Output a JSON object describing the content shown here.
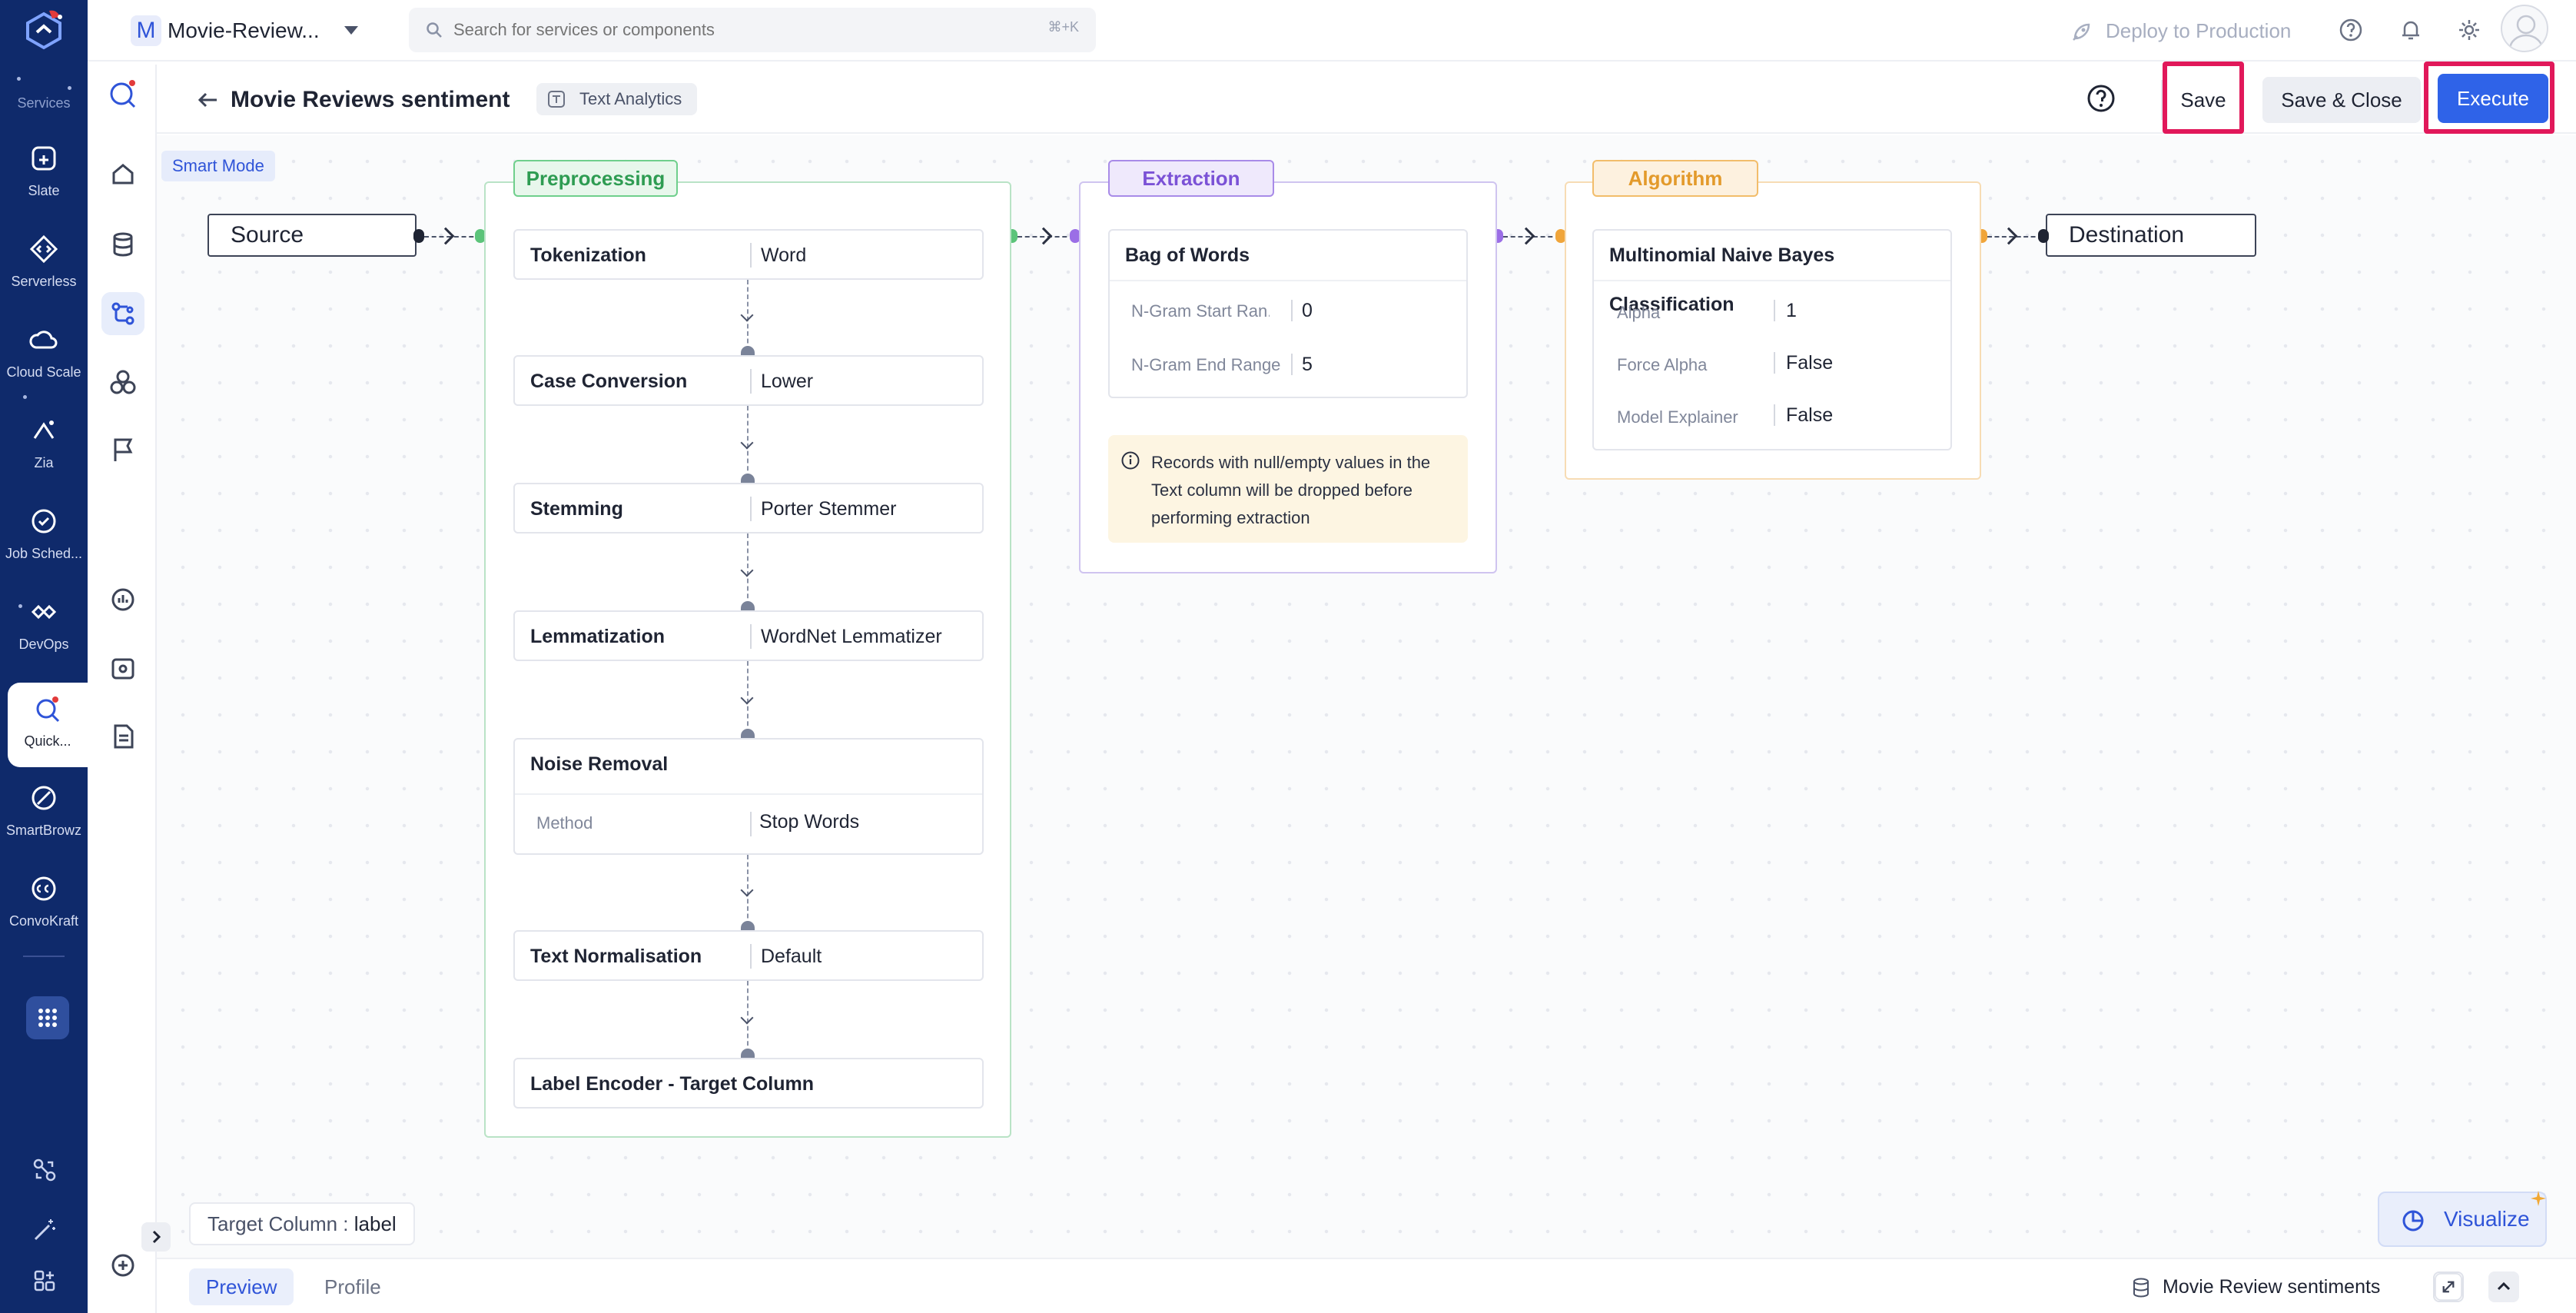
{
  "rail": {
    "services_label": "Services",
    "items": [
      {
        "label": "Slate",
        "icon": "slate-icon"
      },
      {
        "label": "Serverless",
        "icon": "serverless-icon"
      },
      {
        "label": "Cloud Scale",
        "icon": "cloud-scale-icon"
      },
      {
        "label": "Zia",
        "icon": "zia-icon"
      },
      {
        "label": "Job Sched...",
        "icon": "job-scheduling-icon"
      },
      {
        "label": "DevOps",
        "icon": "devops-icon"
      },
      {
        "label": "Quick...",
        "icon": "quickml-icon"
      },
      {
        "label": "SmartBrowz",
        "icon": "smartbrowz-icon"
      },
      {
        "label": "ConvoKraft",
        "icon": "convokraft-icon"
      }
    ]
  },
  "topbar": {
    "project_initial": "M",
    "project_name": "Movie-Review...",
    "search_placeholder": "Search for services or components",
    "search_shortcut": "⌘+K",
    "deploy_label": "Deploy to Production"
  },
  "subheader": {
    "title": "Movie Reviews sentiment",
    "type_tag": "Text Analytics",
    "save_label": "Save",
    "save_close_label": "Save & Close",
    "execute_label": "Execute"
  },
  "canvas": {
    "smart_mode": "Smart Mode",
    "source": "Source",
    "destination": "Destination",
    "preprocessing": {
      "tag": "Preprocessing",
      "steps": [
        {
          "name": "Tokenization",
          "value": "Word"
        },
        {
          "name": "Case Conversion",
          "value": "Lower"
        },
        {
          "name": "Stemming",
          "value": "Porter Stemmer"
        },
        {
          "name": "Lemmatization",
          "value": "WordNet Lemmatizer"
        },
        {
          "name": "Noise Removal",
          "sub_key": "Method",
          "sub_value": "Stop Words"
        },
        {
          "name": "Text Normalisation",
          "value": "Default"
        },
        {
          "name": "Label Encoder - Target Column"
        }
      ]
    },
    "extraction": {
      "tag": "Extraction",
      "card_title": "Bag of Words",
      "params": [
        {
          "key": "N-Gram Start Ran...",
          "value": "0"
        },
        {
          "key": "N-Gram End Range",
          "value": "5"
        }
      ],
      "note": "Records with null/empty values in the Text column will be dropped before performing extraction"
    },
    "algorithm": {
      "tag": "Algorithm",
      "card_title": "Multinomial Naive Bayes Classification",
      "params": [
        {
          "key": "Alpha",
          "value": "1"
        },
        {
          "key": "Force Alpha",
          "value": "False"
        },
        {
          "key": "Model Explainer",
          "value": "False"
        }
      ]
    },
    "target_column_label": "Target Column :",
    "target_column_value": "label",
    "visualize_label": "Visualize"
  },
  "bottombar": {
    "tabs": [
      "Preview",
      "Profile"
    ],
    "dataset_name": "Movie Review sentiments"
  },
  "colors": {
    "rail": "#0f2a6b",
    "accent": "#2f63e8",
    "highlight": "#e1185a",
    "preprocessing": "#2e9c52",
    "extraction": "#7b52d6",
    "algorithm": "#e39a2b"
  }
}
